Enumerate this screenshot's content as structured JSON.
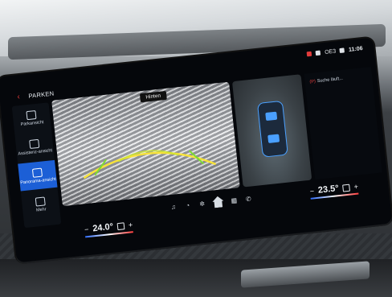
{
  "header": {
    "title": "PARKEN"
  },
  "status_bar": {
    "network": "OE3",
    "time": "11:06"
  },
  "sidebar": {
    "items": [
      {
        "label": "Parkansicht",
        "icon": "parking-view-icon",
        "active": false
      },
      {
        "label": "Assistenz-ansicht",
        "icon": "assist-view-icon",
        "active": false
      },
      {
        "label": "Panorama-ansicht",
        "icon": "panorama-view-icon",
        "active": true
      },
      {
        "label": "Mehr",
        "icon": "more-icon",
        "active": false
      }
    ]
  },
  "camera": {
    "main_label": "Hinten"
  },
  "right_panel": {
    "search_text": "Suche läuft..."
  },
  "climate_left": {
    "minus": "−",
    "temp": "24.0°",
    "plus": "+"
  },
  "climate_right": {
    "minus": "−",
    "temp": "23.5°",
    "plus": "+"
  },
  "dock": [
    {
      "icon": "music-icon",
      "glyph": "♫"
    },
    {
      "icon": "phone-icon",
      "glyph": "◔"
    },
    {
      "icon": "fan-icon",
      "glyph": "✲"
    },
    {
      "icon": "home-icon",
      "glyph": ""
    },
    {
      "icon": "apps-icon",
      "glyph": "▦"
    },
    {
      "icon": "phone-call-icon",
      "glyph": "✆"
    }
  ],
  "colors": {
    "accent": "#1c5fd6",
    "back": "#e33a3a"
  }
}
